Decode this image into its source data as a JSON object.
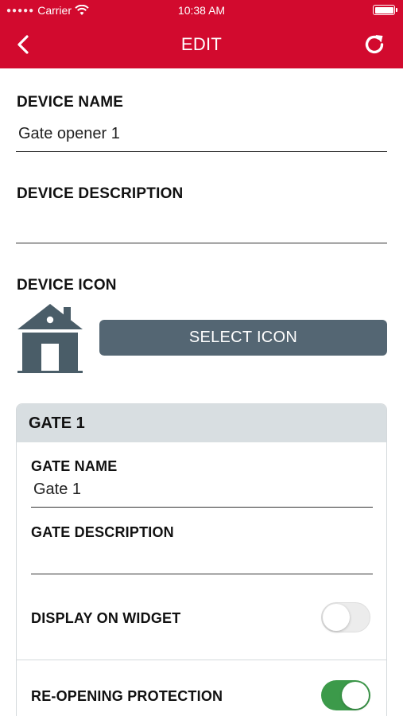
{
  "status_bar": {
    "carrier": "Carrier",
    "time": "10:38 AM",
    "signal_icon": "signal-dots-icon",
    "wifi_icon": "wifi-icon",
    "battery_icon": "battery-icon",
    "battery_level": 1.0
  },
  "nav": {
    "title": "EDIT",
    "back_icon": "chevron-left-icon",
    "refresh_icon": "refresh-icon"
  },
  "device": {
    "name_label": "DEVICE NAME",
    "name_value": "Gate opener 1",
    "description_label": "DEVICE DESCRIPTION",
    "description_value": "",
    "icon_label": "DEVICE ICON",
    "icon": "house-icon",
    "select_icon_label": "SELECT ICON"
  },
  "gate": {
    "title": "GATE 1",
    "name_label": "GATE NAME",
    "name_value": "Gate 1",
    "description_label": "GATE DESCRIPTION",
    "description_value": "",
    "display_on_widget_label": "DISPLAY ON WIDGET",
    "display_on_widget": false,
    "reopening_protection_label": "RE-OPENING PROTECTION",
    "reopening_protection": true
  },
  "colors": {
    "header": "#d20a2e",
    "button": "#546673",
    "toggle_on": "#3c9a4a",
    "card_header": "#d8dee1"
  }
}
